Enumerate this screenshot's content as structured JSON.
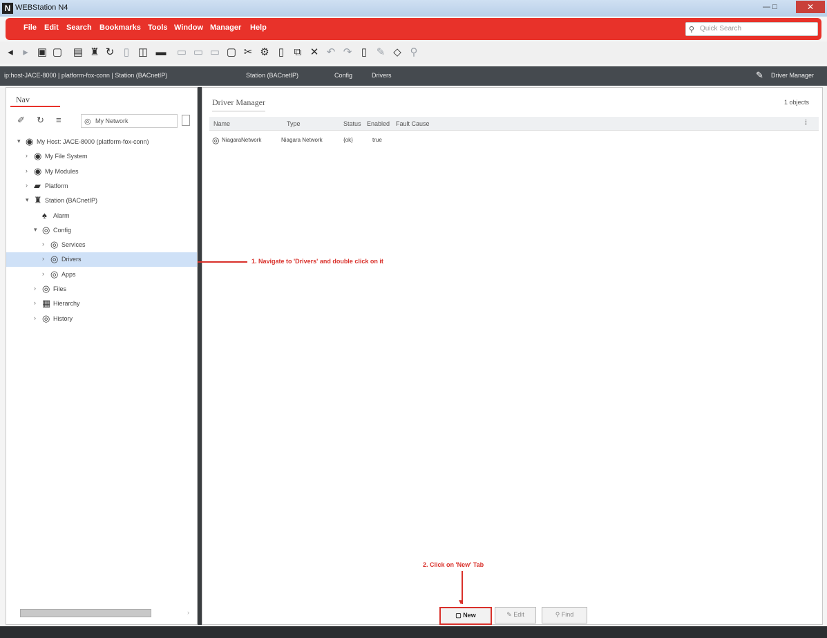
{
  "window": {
    "title": "WEBStation N4",
    "controls": "— □",
    "close": "✕"
  },
  "menu": {
    "items": [
      "File",
      "Edit",
      "Search",
      "Bookmarks",
      "Tools",
      "Window",
      "Manager",
      "Help"
    ],
    "search_placeholder": "Quick Search",
    "search_icon": "search-icon"
  },
  "breadcrumb": {
    "items": [
      "ip:host-JACE-8000 | platform-fox-conn | Station (BACnetIP)",
      "Station (BACnetIP)",
      "Config",
      "Drivers"
    ],
    "view_label": "Driver Manager"
  },
  "nav": {
    "tab_label": "Nav",
    "network_label": "My Network",
    "tree": [
      {
        "label": "My Host: JACE-8000 (platform-fox-conn)",
        "icon": "◉",
        "exp": "▾",
        "level": 0
      },
      {
        "label": "My File System",
        "icon": "◉",
        "exp": "›",
        "level": 1
      },
      {
        "label": "My Modules",
        "icon": "◉",
        "exp": "›",
        "level": 1
      },
      {
        "label": "Platform",
        "icon": "▰",
        "exp": "›",
        "level": 1
      },
      {
        "label": "Station (BACnetIP)",
        "icon": "♜",
        "exp": "▾",
        "level": 1
      },
      {
        "label": "Alarm",
        "icon": "♠",
        "exp": "",
        "level": 2
      },
      {
        "label": "Config",
        "icon": "◎",
        "exp": "▾",
        "level": 2
      },
      {
        "label": "Services",
        "icon": "◎",
        "exp": "›",
        "level": 3
      },
      {
        "label": "Drivers",
        "icon": "◎",
        "exp": "›",
        "level": 3,
        "selected": true
      },
      {
        "label": "Apps",
        "icon": "◎",
        "exp": "›",
        "level": 3
      },
      {
        "label": "Files",
        "icon": "◎",
        "exp": "›",
        "level": 2
      },
      {
        "label": "Hierarchy",
        "icon": "▦",
        "exp": "›",
        "level": 2
      },
      {
        "label": "History",
        "icon": "◎",
        "exp": "›",
        "level": 2
      }
    ]
  },
  "main": {
    "title": "Driver Manager",
    "object_count": "1 objects",
    "columns": [
      "Name",
      "Type",
      "Status",
      "Enabled",
      "Fault Cause"
    ],
    "rows": [
      {
        "name": "NiagaraNetwork",
        "type": "Niagara Network",
        "status": "{ok}",
        "enabled": "true",
        "fault": ""
      }
    ]
  },
  "annotations": {
    "step1": "1. Navigate to 'Drivers' and double click on it",
    "step2": "2. Click on 'New' Tab"
  },
  "buttons": {
    "new": "New",
    "edit": "Edit",
    "find": "Find"
  },
  "colors": {
    "accent": "#e8322a",
    "annotation": "#d9302a",
    "path_bar": "#454a4f",
    "selection": "#cfe1f7"
  }
}
